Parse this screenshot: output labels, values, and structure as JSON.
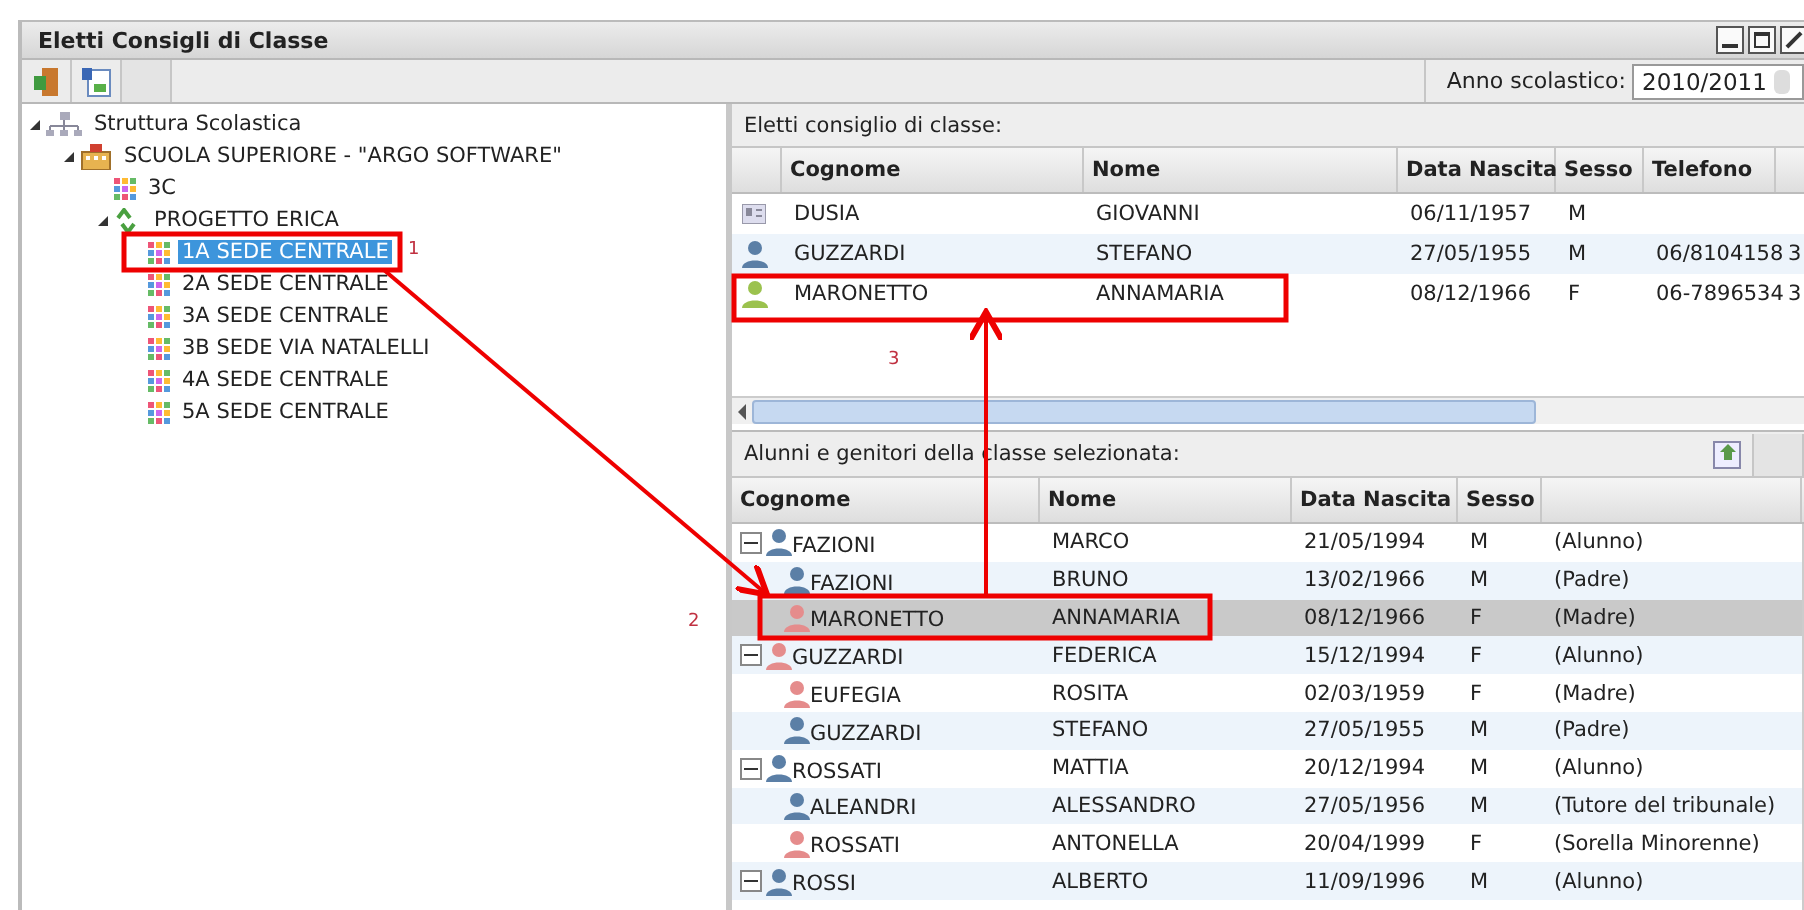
{
  "window": {
    "title": "Eletti Consigli di Classe"
  },
  "toolbar": {
    "school_year_label": "Anno scolastico:",
    "school_year": "2010/2011"
  },
  "tree": [
    {
      "label": "Struttura Scolastica",
      "kind": "root",
      "expanded": true,
      "selected": false,
      "children": [
        {
          "label": "SCUOLA SUPERIORE - \"ARGO SOFTWARE\"",
          "kind": "school",
          "expanded": true,
          "selected": false,
          "children": [
            {
              "label": "3C",
              "kind": "class",
              "selected": false
            },
            {
              "label": "PROGETTO ERICA",
              "kind": "project",
              "expanded": true,
              "selected": false,
              "children": [
                {
                  "label": "1A SEDE CENTRALE",
                  "kind": "class",
                  "selected": true
                },
                {
                  "label": "2A SEDE CENTRALE",
                  "kind": "class",
                  "selected": false
                },
                {
                  "label": "3A SEDE CENTRALE",
                  "kind": "class",
                  "selected": false
                },
                {
                  "label": "3B SEDE VIA NATALELLI",
                  "kind": "class",
                  "selected": false
                },
                {
                  "label": "4A SEDE CENTRALE",
                  "kind": "class",
                  "selected": false
                },
                {
                  "label": "5A SEDE CENTRALE",
                  "kind": "class",
                  "selected": false
                }
              ]
            }
          ]
        }
      ]
    }
  ],
  "elected": {
    "title": "Eletti consiglio di classe:",
    "columns": [
      "Cognome",
      "Nome",
      "Data Nascita",
      "Sesso",
      "Telefono"
    ],
    "rows": [
      {
        "kind": "card",
        "cognome": "DUSIA",
        "nome": "GIOVANNI",
        "data_nascita": "06/11/1957",
        "sesso": "M"
      },
      {
        "kind": "male",
        "cognome": "GUZZARDI",
        "nome": "STEFANO",
        "data_nascita": "27/05/1955",
        "sesso": "M",
        "telefono": "06/8104158",
        "column_6": "3"
      },
      {
        "kind": "parent",
        "cognome": "MARONETTO",
        "nome": "ANNAMARIA",
        "data_nascita": "08/12/1966",
        "sesso": "F",
        "telefono": "06-7896534",
        "column_6": "3"
      }
    ]
  },
  "students": {
    "title": "Alunni e genitori della classe selezionata:",
    "columns": [
      "Cognome",
      "Nome",
      "Data Nascita",
      "Sesso"
    ],
    "rows": [
      {
        "kind": "male",
        "cognome": "FAZIONI",
        "nome": "MARCO",
        "data_nascita": "21/05/1994",
        "sesso": "M",
        "column_5": "(Alunno)",
        "expanded": true,
        "selected": false,
        "children": [
          {
            "kind": "male",
            "cognome": "FAZIONI",
            "nome": "BRUNO",
            "data_nascita": "13/02/1966",
            "sesso": "M",
            "column_5": "(Padre)",
            "selected": false
          },
          {
            "kind": "female",
            "cognome": "MARONETTO",
            "nome": "ANNAMARIA",
            "data_nascita": "08/12/1966",
            "sesso": "F",
            "column_5": "(Madre)",
            "selected": true
          }
        ]
      },
      {
        "kind": "female",
        "cognome": "GUZZARDI",
        "nome": "FEDERICA",
        "data_nascita": "15/12/1994",
        "sesso": "F",
        "column_5": "(Alunno)",
        "expanded": true,
        "selected": false,
        "children": [
          {
            "kind": "female",
            "cognome": "EUFEGIA",
            "nome": "ROSITA",
            "data_nascita": "02/03/1959",
            "sesso": "F",
            "column_5": "(Madre)",
            "selected": false
          },
          {
            "kind": "male",
            "cognome": "GUZZARDI",
            "nome": "STEFANO",
            "data_nascita": "27/05/1955",
            "sesso": "M",
            "column_5": "(Padre)",
            "selected": false
          }
        ]
      },
      {
        "kind": "male",
        "cognome": "ROSSATI",
        "nome": "MATTIA",
        "data_nascita": "20/12/1994",
        "sesso": "M",
        "column_5": "(Alunno)",
        "expanded": true,
        "selected": false,
        "children": [
          {
            "kind": "male",
            "cognome": "ALEANDRI",
            "nome": "ALESSANDRO",
            "data_nascita": "27/05/1956",
            "sesso": "M",
            "column_5": "(Tutore del tribunale)",
            "selected": false
          },
          {
            "kind": "female",
            "cognome": "ROSSATI",
            "nome": "ANTONELLA",
            "data_nascita": "20/04/1999",
            "sesso": "F",
            "column_5": "(Sorella Minorenne)",
            "selected": false
          }
        ]
      },
      {
        "kind": "male",
        "cognome": "ROSSI",
        "nome": "ALBERTO",
        "data_nascita": "11/09/1996",
        "sesso": "M",
        "column_5": "(Alunno)",
        "expanded": true,
        "selected": false
      }
    ]
  },
  "annotations": [
    {
      "label": "1"
    },
    {
      "label": "2"
    },
    {
      "label": "3"
    }
  ]
}
